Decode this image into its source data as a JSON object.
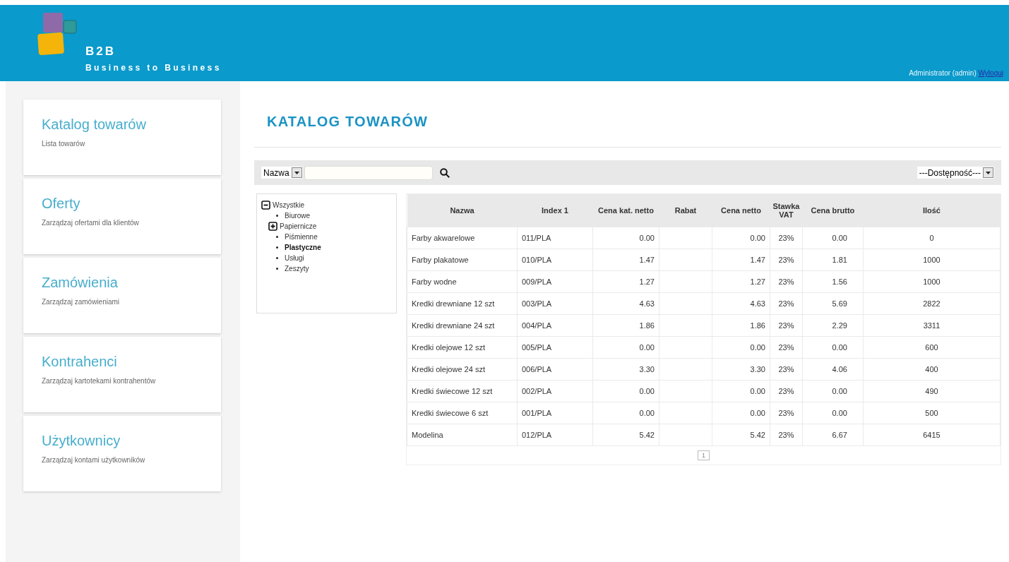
{
  "header": {
    "logo_title": "B2B",
    "logo_subtitle": "Business to Business",
    "user": "Administrator (admin)",
    "logout": "Wyloguj"
  },
  "sidebar": {
    "items": [
      {
        "title": "Katalog towarów",
        "subtitle": "Lista towarów"
      },
      {
        "title": "Oferty",
        "subtitle": "Zarządzaj ofertami dla klientów"
      },
      {
        "title": "Zamówienia",
        "subtitle": "Zarządzaj zamówieniami"
      },
      {
        "title": "Kontrahenci",
        "subtitle": "Zarządzaj kartotekami kontrahentów"
      },
      {
        "title": "Użytkownicy",
        "subtitle": "Zarządzaj kontami użytkowników"
      }
    ]
  },
  "page_title": "KATALOG TOWARÓW",
  "filter": {
    "field_select": "Nazwa",
    "availability_select": "---Dostępność---"
  },
  "tree": [
    {
      "label": "Wszystkie",
      "kind": "group",
      "expanded": true,
      "selected": false,
      "children": [
        {
          "label": "Biurowe",
          "kind": "item",
          "selected": false
        },
        {
          "label": "Papiernicze",
          "kind": "group",
          "expanded": false,
          "selected": false
        },
        {
          "label": "Piśmienne",
          "kind": "item",
          "selected": false
        },
        {
          "label": "Plastyczne",
          "kind": "item",
          "selected": true
        },
        {
          "label": "Usługi",
          "kind": "item",
          "selected": false
        },
        {
          "label": "Zeszyty",
          "kind": "item",
          "selected": false
        }
      ]
    }
  ],
  "table": {
    "columns": [
      "Nazwa",
      "Index 1",
      "Cena kat. netto",
      "Rabat",
      "Cena netto",
      "Stawka VAT",
      "Cena brutto",
      "Ilość"
    ],
    "rows": [
      [
        "Farby akwarelowe",
        "011/PLA",
        "0.00",
        "",
        "0.00",
        "23%",
        "0.00",
        "0"
      ],
      [
        "Farby plakatowe",
        "010/PLA",
        "1.47",
        "",
        "1.47",
        "23%",
        "1.81",
        "1000"
      ],
      [
        "Farby wodne",
        "009/PLA",
        "1.27",
        "",
        "1.27",
        "23%",
        "1.56",
        "1000"
      ],
      [
        "Kredki drewniane 12 szt",
        "003/PLA",
        "4.63",
        "",
        "4.63",
        "23%",
        "5.69",
        "2822"
      ],
      [
        "Kredki drewniane 24 szt",
        "004/PLA",
        "1.86",
        "",
        "1.86",
        "23%",
        "2.29",
        "3311"
      ],
      [
        "Kredki olejowe 12 szt",
        "005/PLA",
        "0.00",
        "",
        "0.00",
        "23%",
        "0.00",
        "600"
      ],
      [
        "Kredki olejowe 24 szt",
        "006/PLA",
        "3.30",
        "",
        "3.30",
        "23%",
        "4.06",
        "400"
      ],
      [
        "Kredki świecowe 12 szt",
        "002/PLA",
        "0.00",
        "",
        "0.00",
        "23%",
        "0.00",
        "490"
      ],
      [
        "Kredki świecowe 6 szt",
        "001/PLA",
        "0.00",
        "",
        "0.00",
        "23%",
        "0.00",
        "500"
      ],
      [
        "Modelina",
        "012/PLA",
        "5.42",
        "",
        "5.42",
        "23%",
        "6.67",
        "6415"
      ]
    ],
    "pages": [
      {
        "label": "1",
        "selected": true
      }
    ]
  }
}
